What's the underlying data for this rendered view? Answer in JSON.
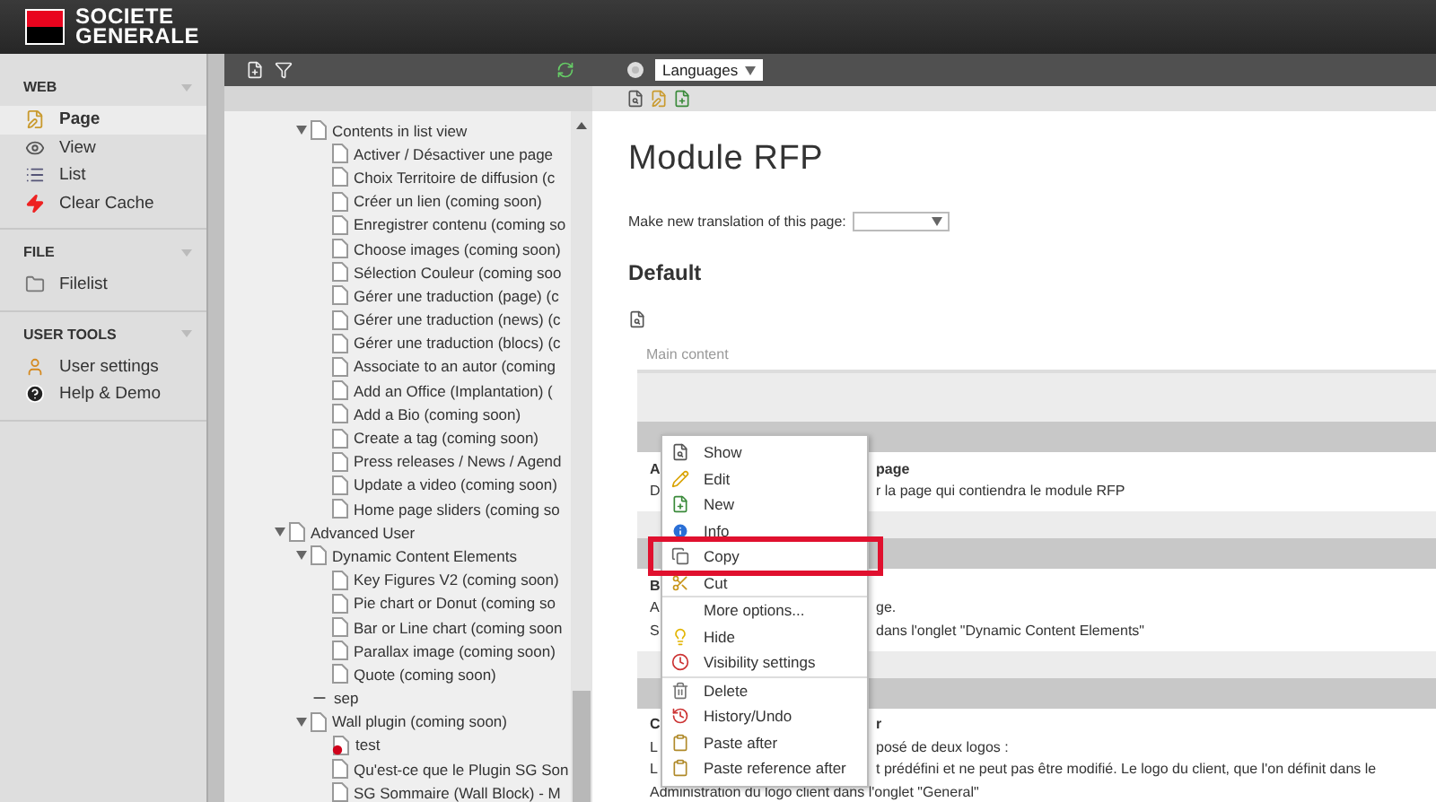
{
  "brand": {
    "line1": "SOCIETE",
    "line2": "GENERALE"
  },
  "module_menu": [
    {
      "title": "WEB",
      "items": [
        {
          "label": "Page",
          "selected": true
        },
        {
          "label": "View",
          "selected": false
        },
        {
          "label": "List",
          "selected": false
        },
        {
          "label": "Clear Cache",
          "selected": false
        }
      ]
    },
    {
      "title": "FILE",
      "items": [
        {
          "label": "Filelist",
          "selected": false
        }
      ]
    },
    {
      "title": "USER TOOLS",
      "items": [
        {
          "label": "User settings",
          "selected": false
        },
        {
          "label": "Help & Demo",
          "selected": false
        }
      ]
    }
  ],
  "tree": {
    "items": [
      {
        "children": [
          {
            "label": "Contents in list view",
            "kind": "page",
            "expanded": true,
            "children": [
              {
                "label": "Activer / Désactiver une page",
                "kind": "page"
              },
              {
                "label": "Choix Territoire de diffusion (c",
                "kind": "page"
              },
              {
                "label": "Créer un lien (coming soon)",
                "kind": "page"
              },
              {
                "label": "Enregistrer contenu (coming so",
                "kind": "page"
              },
              {
                "label": "Choose images (coming soon)",
                "kind": "page"
              },
              {
                "label": "Sélection Couleur (coming soo",
                "kind": "page"
              },
              {
                "label": "Gérer une traduction (page) (c",
                "kind": "page"
              },
              {
                "label": "Gérer une traduction (news) (c",
                "kind": "page"
              },
              {
                "label": "Gérer une traduction (blocs) (c",
                "kind": "page"
              },
              {
                "label": "Associate to an autor (coming",
                "kind": "page"
              },
              {
                "label": "Add an Office (Implantation) (",
                "kind": "page"
              },
              {
                "label": "Add a Bio (coming soon)",
                "kind": "page"
              },
              {
                "label": "Create a tag (coming soon)",
                "kind": "page"
              },
              {
                "label": "Press releases / News / Agend",
                "kind": "page"
              },
              {
                "label": "Update a video (coming soon)",
                "kind": "page"
              },
              {
                "label": "Home page sliders (coming so",
                "kind": "page"
              }
            ]
          }
        ]
      },
      {
        "label": "Advanced User",
        "kind": "page",
        "expanded": true,
        "children": [
          {
            "label": "Dynamic Content Elements",
            "kind": "page",
            "expanded": true,
            "children": [
              {
                "label": "Key Figures V2 (coming soon)",
                "kind": "page"
              },
              {
                "label": "Pie chart or Donut (coming so",
                "kind": "page"
              },
              {
                "label": "Bar or Line chart (coming soon",
                "kind": "page"
              },
              {
                "label": "Parallax image (coming soon)",
                "kind": "page"
              },
              {
                "label": "Quote (coming soon)",
                "kind": "page"
              }
            ]
          },
          {
            "label": "sep",
            "kind": "separator"
          },
          {
            "label": "Wall plugin (coming soon)",
            "kind": "page",
            "expanded": true,
            "children": [
              {
                "label": "test",
                "kind": "restricted"
              },
              {
                "label": "Qu'est-ce que le Plugin SG Son",
                "kind": "page"
              },
              {
                "label": "SG Sommaire (Wall Block) - M",
                "kind": "page"
              }
            ]
          }
        ]
      }
    ]
  },
  "languages": {
    "label": "Languages"
  },
  "page": {
    "title": "Module RFP",
    "translation_label": "Make new translation of this page:",
    "column_title": "Default",
    "column_label": "Main content"
  },
  "sections": [
    {
      "lines": [
        {
          "left": "A",
          "right": "page",
          "bold": true
        },
        {
          "left": "D",
          "right": "r la page qui contiendra le module RFP",
          "bold": false
        }
      ]
    },
    {
      "lines": [
        {
          "left": "B",
          "bold": true
        },
        {
          "left": "A",
          "right": "ge.",
          "bold": false
        },
        {
          "left": "S",
          "right": "dans l'onglet \"Dynamic Content Elements\"",
          "bold": false
        }
      ]
    },
    {
      "lines": [
        {
          "left": "C",
          "right": "r",
          "bold": true
        },
        {
          "left": "L",
          "right": "posé de deux logos :",
          "bold": false
        },
        {
          "left": "L",
          "right": "t prédéfini et ne peut pas être modifié. Le logo du client, que l'on définit dans le",
          "bold": false
        },
        {
          "text": "Administration du logo client dans l'onglet \"General\"",
          "bold": false
        }
      ]
    }
  ],
  "context_menu": [
    {
      "label": "Show",
      "highlighted": false,
      "divider_before": false
    },
    {
      "label": "Edit",
      "highlighted": false,
      "divider_before": false
    },
    {
      "label": "New",
      "highlighted": false,
      "divider_before": false
    },
    {
      "label": "Info",
      "highlighted": false,
      "divider_before": false
    },
    {
      "label": "Copy",
      "highlighted": true,
      "divider_before": false
    },
    {
      "label": "Cut",
      "highlighted": false,
      "divider_before": false
    },
    {
      "label": "More options...",
      "highlighted": false,
      "divider_before": true
    },
    {
      "label": "Hide",
      "highlighted": false,
      "divider_before": false
    },
    {
      "label": "Visibility settings",
      "highlighted": false,
      "divider_before": false
    },
    {
      "label": "Delete",
      "highlighted": false,
      "divider_before": true
    },
    {
      "label": "History/Undo",
      "highlighted": false,
      "divider_before": false
    },
    {
      "label": "Paste after",
      "highlighted": false,
      "divider_before": false
    },
    {
      "label": "Paste reference after",
      "highlighted": false,
      "divider_before": false
    }
  ]
}
